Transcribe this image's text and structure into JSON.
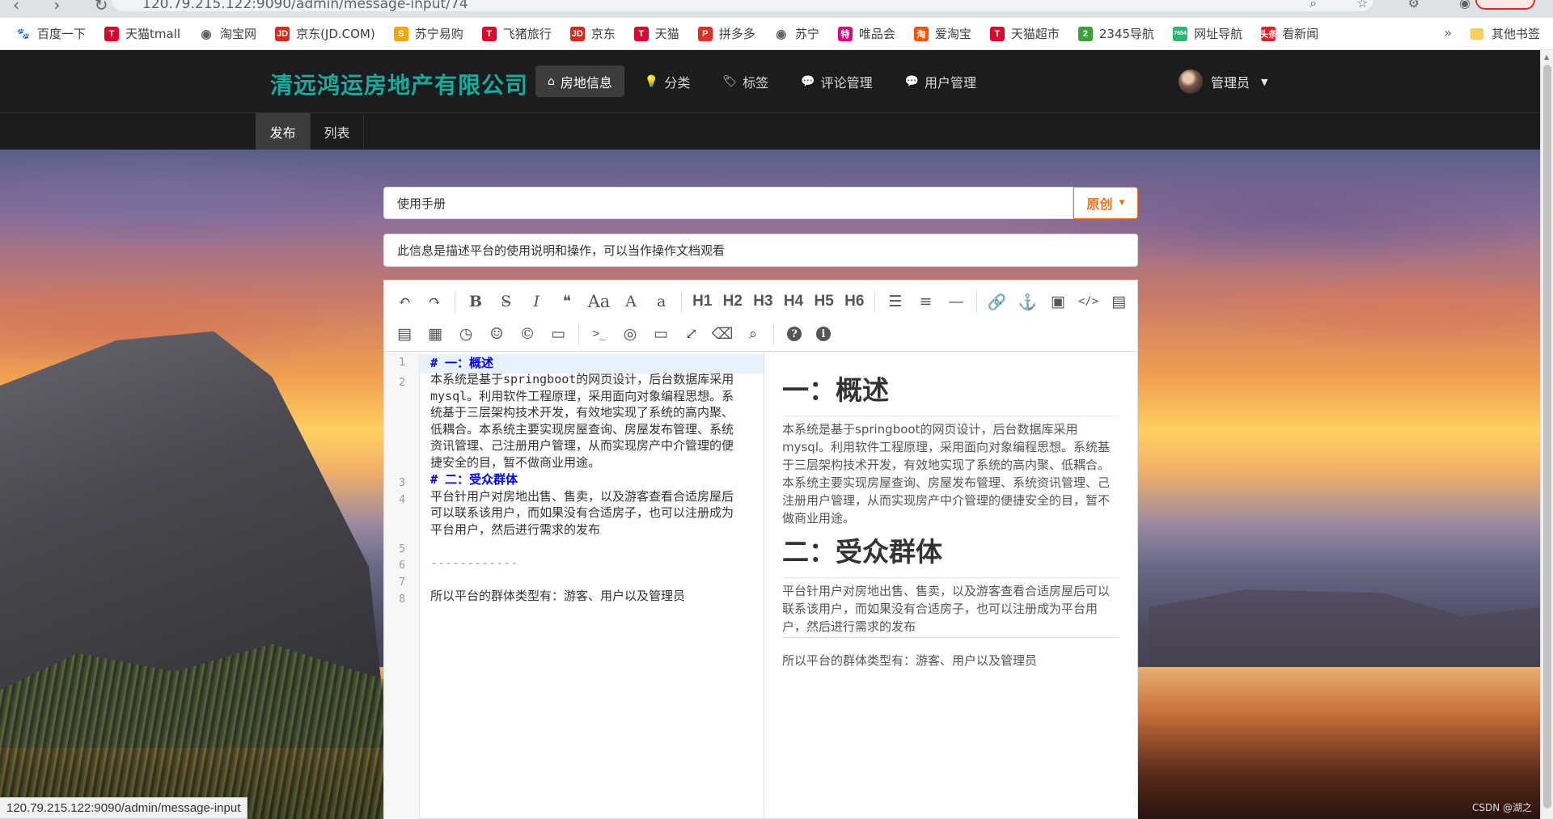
{
  "browser": {
    "url": "120.79.215.122:9090/admin/message-input/74",
    "bookmarks": [
      {
        "label": "百度一下",
        "ico": "paw",
        "color": "#2932e1"
      },
      {
        "label": "天猫tmall",
        "ico": "T",
        "color": "#e4002b"
      },
      {
        "label": "淘宝网",
        "ico": "globe",
        "color": "#5f6368"
      },
      {
        "label": "京东(JD.COM)",
        "ico": "JD",
        "color": "#e1251b"
      },
      {
        "label": "苏宁易购",
        "ico": "S",
        "color": "#f7a500"
      },
      {
        "label": "飞猪旅行",
        "ico": "T",
        "color": "#e4002b"
      },
      {
        "label": "京东",
        "ico": "JD",
        "color": "#e1251b"
      },
      {
        "label": "天猫",
        "ico": "T",
        "color": "#e4002b"
      },
      {
        "label": "拼多多",
        "ico": "P",
        "color": "#e02e24"
      },
      {
        "label": "苏宁",
        "ico": "globe",
        "color": "#5f6368"
      },
      {
        "label": "唯品会",
        "ico": "特",
        "color": "#e5007f"
      },
      {
        "label": "爱淘宝",
        "ico": "淘",
        "color": "#ff5000"
      },
      {
        "label": "天猫超市",
        "ico": "T",
        "color": "#e4002b"
      },
      {
        "label": "2345导航",
        "ico": "2",
        "color": "#3aa335"
      },
      {
        "label": "网址导航",
        "ico": "7654",
        "color": "#2bb673"
      },
      {
        "label": "看新闻",
        "ico": "头条",
        "color": "#e02020"
      }
    ],
    "more": "»",
    "other_bookmarks": "其他书签",
    "status_url": "120.79.215.122:9090/admin/message-input"
  },
  "header": {
    "brand": "清远鸿运房地产有限公司",
    "nav": [
      {
        "label": "房地信息",
        "icon": "home-icon",
        "glyph": "⌂",
        "active": true
      },
      {
        "label": "分类",
        "icon": "lightbulb-icon",
        "glyph": "💡",
        "active": false
      },
      {
        "label": "标签",
        "icon": "tag-icon",
        "glyph": "🏷",
        "active": false
      },
      {
        "label": "评论管理",
        "icon": "comment-icon",
        "glyph": "💬",
        "active": false
      },
      {
        "label": "用户管理",
        "icon": "comment-icon",
        "glyph": "💬",
        "active": false
      }
    ],
    "user": "管理员"
  },
  "subnav": [
    {
      "label": "发布",
      "active": true
    },
    {
      "label": "列表",
      "active": false
    }
  ],
  "form": {
    "title_value": "使用手册",
    "flag": "原创",
    "description_value": "此信息是描述平台的使用说明和操作，可以当作操作文档观看"
  },
  "toolbar": {
    "row1": [
      "undo-icon",
      "redo-icon",
      "|",
      "bold-icon",
      "strikethrough-icon",
      "italic-icon",
      "quote-icon",
      "uppercase-icon",
      "ucwords-icon",
      "lowercase-icon",
      "|",
      "H1",
      "H2",
      "H3",
      "H4",
      "H5",
      "H6",
      "|",
      "unordered-list-icon",
      "ordered-list-icon",
      "hr-icon",
      "|",
      "link-icon",
      "anchor-icon",
      "image-icon",
      "code-icon",
      "code-block-icon"
    ],
    "row2": [
      "pre-icon",
      "table-icon",
      "datetime-icon",
      "emoji-icon",
      "html-entities-icon",
      "pagebreak-icon",
      "|",
      "terminal-icon",
      "watch-icon",
      "preview-icon",
      "fullscreen-icon",
      "clear-icon",
      "search-icon",
      "|",
      "help-icon",
      "info-icon"
    ]
  },
  "editor": {
    "line_numbers": [
      "1",
      "2",
      "3",
      "4",
      "5",
      "6",
      "7",
      "8"
    ],
    "code_lines": [
      "#  一：概述",
      "本系统是基于springboot的网页设计，后台数据库采用",
      "mysql。利用软件工程原理，采用面向对象编程思想。系",
      "统基于三层架构技术开发，有效地实现了系统的高内聚、",
      "低耦合。本系统主要实现房屋查询、房屋发布管理、系统",
      "资讯管理、己注册用户管理，从而实现房产中介管理的便",
      "捷安全的目，暂不做商业用途。",
      "# 二：受众群体",
      "平台针用户对房地出售、售卖，以及游客查看合适房屋后",
      "可以联系该用户，而如果没有合适房子，也可以注册成为",
      "平台用户，然后进行需求的发布",
      "------------",
      "所以平台的群体类型有：游客、用户以及管理员"
    ]
  },
  "preview": {
    "h1_a": "一：概述",
    "p_a": [
      "本系统是基于springboot的网页设计，后台数据库采用",
      "mysql。利用软件工程原理，采用面向对象编程思想。系统基",
      "于三层架构技术开发，有效地实现了系统的高内聚、低耦合。",
      "本系统主要实现房屋查询、房屋发布管理、系统资讯管理、己",
      "注册用户管理，从而实现房产中介管理的便捷安全的目，暂不",
      "做商业用途。"
    ],
    "h1_b": "二：受众群体",
    "p_b": [
      "平台针用户对房地出售、售卖，以及游客查看合适房屋后可以",
      "联系该用户，而如果没有合适房子，也可以注册成为平台用",
      "户，然后进行需求的发布"
    ],
    "p_c": "所以平台的群体类型有：游客、用户以及管理员"
  },
  "watermark": "CSDN @湖之"
}
